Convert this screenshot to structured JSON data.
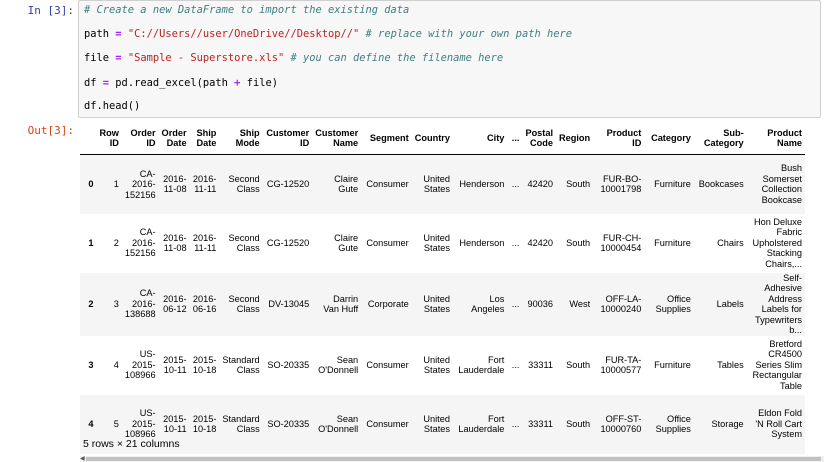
{
  "cell": {
    "in_prompt": "In [3]:",
    "out_prompt": "Out[3]:",
    "code": [
      {
        "parts": [
          {
            "t": "comment",
            "v": "# Create a new DataFrame to import the existing data"
          }
        ]
      },
      {
        "parts": [
          {
            "t": "plain",
            "v": "path "
          },
          {
            "t": "op",
            "v": "="
          },
          {
            "t": "plain",
            "v": " "
          },
          {
            "t": "string",
            "v": "\"C://Users//user/OneDrive//Desktop//\""
          },
          {
            "t": "plain",
            "v": " "
          },
          {
            "t": "comment",
            "v": "# replace with your own path here"
          }
        ]
      },
      {
        "parts": [
          {
            "t": "plain",
            "v": "file "
          },
          {
            "t": "op",
            "v": "="
          },
          {
            "t": "plain",
            "v": " "
          },
          {
            "t": "string",
            "v": "\"Sample - Superstore.xls\""
          },
          {
            "t": "plain",
            "v": " "
          },
          {
            "t": "comment",
            "v": "# you can define the filename here"
          }
        ]
      },
      {
        "parts": [
          {
            "t": "plain",
            "v": "df "
          },
          {
            "t": "op",
            "v": "="
          },
          {
            "t": "plain",
            "v": " pd.read_excel(path "
          },
          {
            "t": "op",
            "v": "+"
          },
          {
            "t": "plain",
            "v": " file)"
          }
        ]
      },
      {
        "parts": [
          {
            "t": "plain",
            "v": "df.head()"
          }
        ]
      }
    ]
  },
  "table": {
    "columns": [
      "",
      "Row ID",
      "Order ID",
      "Order Date",
      "Ship Date",
      "Ship Mode",
      "Customer ID",
      "Customer Name",
      "Segment",
      "Country",
      "City",
      "...",
      "Postal Code",
      "Region",
      "Product ID",
      "Category",
      "Sub-Category",
      "Product Name"
    ],
    "rows": [
      [
        "0",
        "1",
        "CA-2016-152156",
        "2016-11-08",
        "2016-11-11",
        "Second Class",
        "CG-12520",
        "Claire Gute",
        "Consumer",
        "United States",
        "Henderson",
        "...",
        "42420",
        "South",
        "FUR-BO-10001798",
        "Furniture",
        "Bookcases",
        "Bush Somerset Collection Bookcase"
      ],
      [
        "1",
        "2",
        "CA-2016-152156",
        "2016-11-08",
        "2016-11-11",
        "Second Class",
        "CG-12520",
        "Claire Gute",
        "Consumer",
        "United States",
        "Henderson",
        "...",
        "42420",
        "South",
        "FUR-CH-10000454",
        "Furniture",
        "Chairs",
        "Hon Deluxe Fabric Upholstered Stacking Chairs,..."
      ],
      [
        "2",
        "3",
        "CA-2016-138688",
        "2016-06-12",
        "2016-06-16",
        "Second Class",
        "DV-13045",
        "Darrin Van Huff",
        "Corporate",
        "United States",
        "Los Angeles",
        "...",
        "90036",
        "West",
        "OFF-LA-10000240",
        "Office Supplies",
        "Labels",
        "Self-Adhesive Address Labels for Typewriters b..."
      ],
      [
        "3",
        "4",
        "US-2015-108966",
        "2015-10-11",
        "2015-10-18",
        "Standard Class",
        "SO-20335",
        "Sean O'Donnell",
        "Consumer",
        "United States",
        "Fort Lauderdale",
        "...",
        "33311",
        "South",
        "FUR-TA-10000577",
        "Furniture",
        "Tables",
        "Bretford CR4500 Series Slim Rectangular Table"
      ],
      [
        "4",
        "5",
        "US-2015-108966",
        "2015-10-11",
        "2015-10-18",
        "Standard Class",
        "SO-20335",
        "Sean O'Donnell",
        "Consumer",
        "United States",
        "Fort Lauderdale",
        "...",
        "33311",
        "South",
        "OFF-ST-10000760",
        "Office Supplies",
        "Storage",
        "Eldon Fold 'N Roll Cart System"
      ]
    ],
    "shape": "5 rows × 21 columns"
  },
  "colors": {
    "in_prompt": "#303f9f",
    "out_prompt": "#d84315",
    "comment": "#408080",
    "string": "#ba2121",
    "operator": "#aa22ff"
  }
}
